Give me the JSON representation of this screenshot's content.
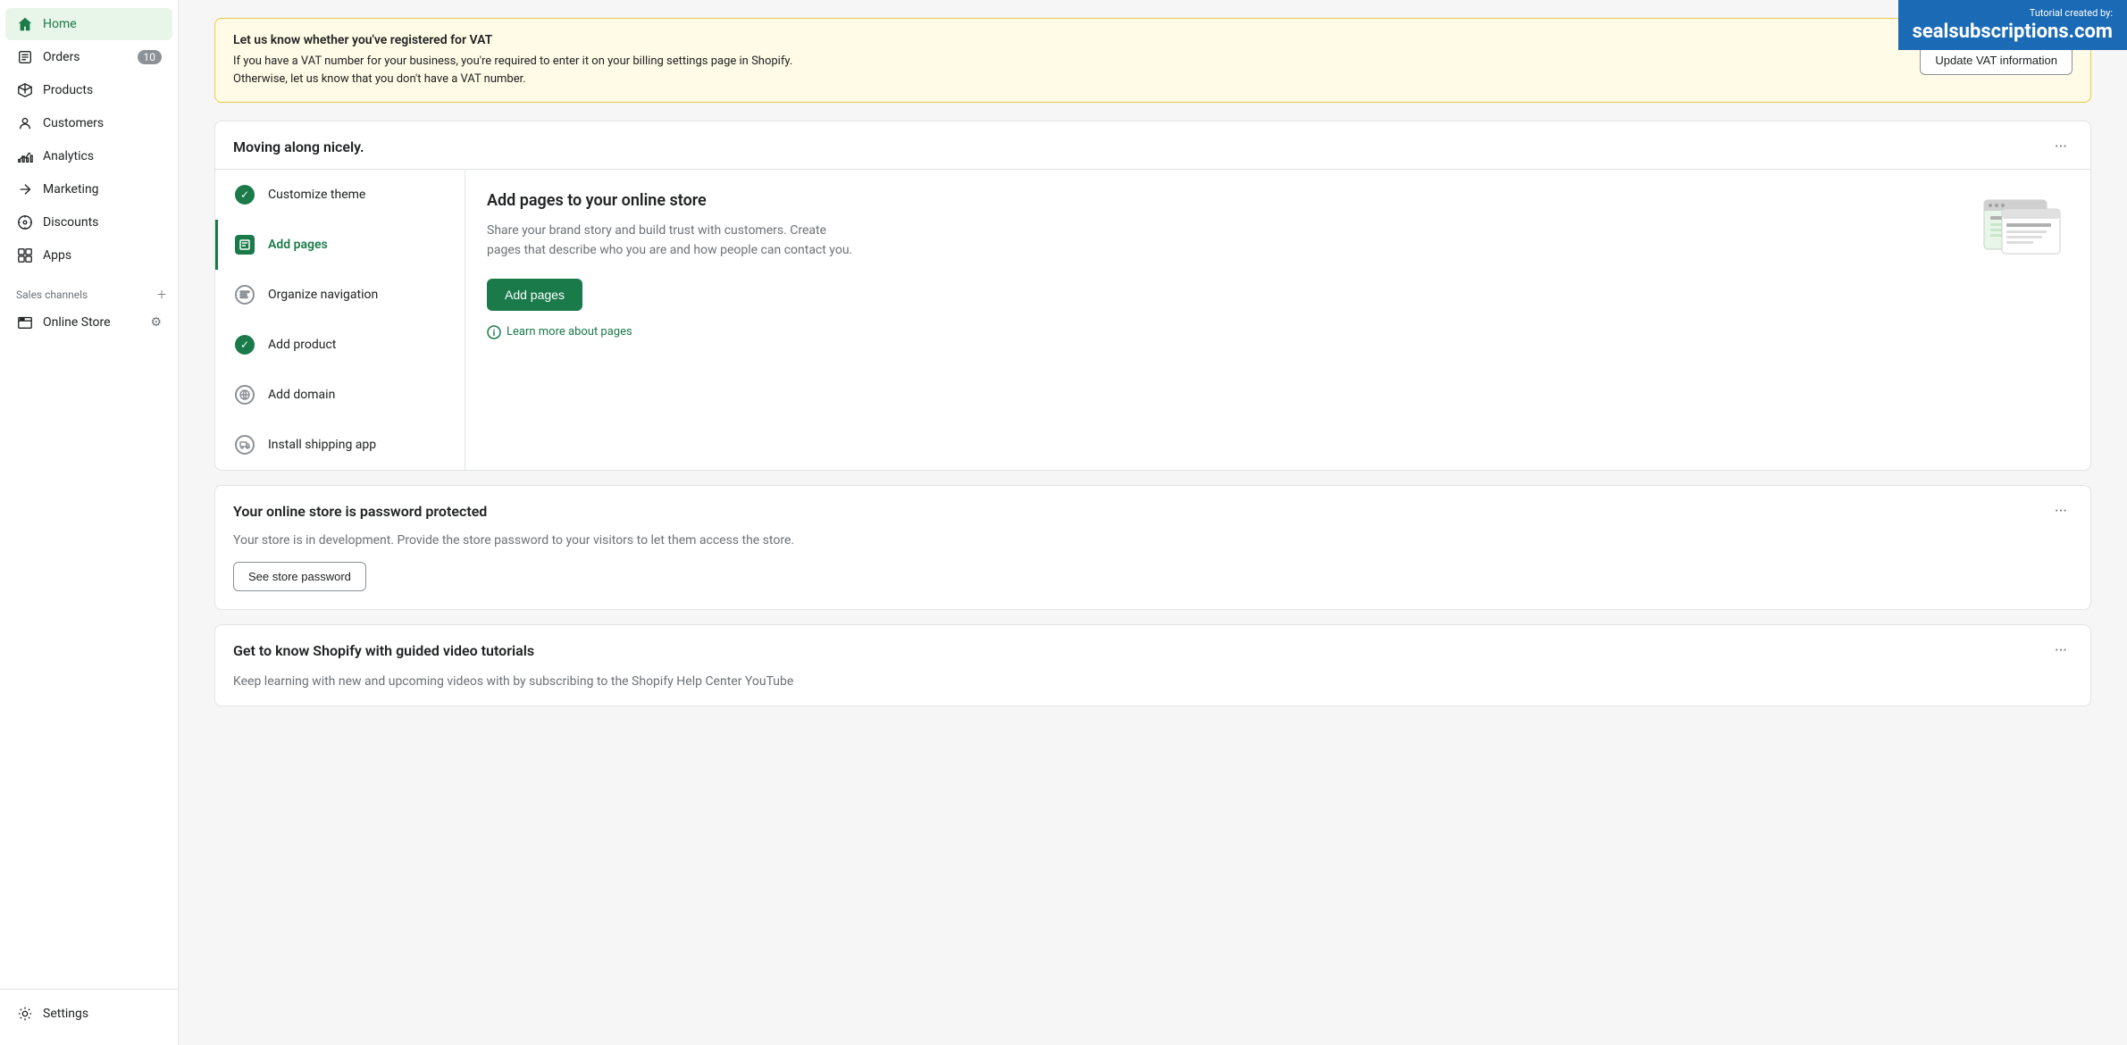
{
  "sidebar": {
    "items": [
      {
        "id": "home",
        "label": "Home",
        "icon": "home",
        "active": true,
        "badge": null
      },
      {
        "id": "orders",
        "label": "Orders",
        "icon": "orders",
        "active": false,
        "badge": "10"
      },
      {
        "id": "products",
        "label": "Products",
        "icon": "products",
        "active": false,
        "badge": null
      },
      {
        "id": "customers",
        "label": "Customers",
        "icon": "customers",
        "active": false,
        "badge": null
      },
      {
        "id": "analytics",
        "label": "Analytics",
        "icon": "analytics",
        "active": false,
        "badge": null
      },
      {
        "id": "marketing",
        "label": "Marketing",
        "icon": "marketing",
        "active": false,
        "badge": null
      },
      {
        "id": "discounts",
        "label": "Discounts",
        "icon": "discounts",
        "active": false,
        "badge": null
      },
      {
        "id": "apps",
        "label": "Apps",
        "icon": "apps",
        "active": false,
        "badge": null
      }
    ],
    "sales_channels_label": "Sales channels",
    "online_store_label": "Online Store",
    "settings_label": "Settings"
  },
  "vat_banner": {
    "title": "Let us know whether you've registered for VAT",
    "description": "If you have a VAT number for your business, you're required to enter it on your billing settings page in Shopify. Otherwise, let us know that you don't have a VAT number.",
    "button_label": "Update VAT information"
  },
  "moving_along": {
    "title": "Moving along nicely.",
    "more_label": "···",
    "steps": [
      {
        "id": "customize-theme",
        "label": "Customize theme",
        "status": "complete"
      },
      {
        "id": "add-pages",
        "label": "Add pages",
        "status": "active"
      },
      {
        "id": "organize-navigation",
        "label": "Organize navigation",
        "status": "pending"
      },
      {
        "id": "add-product",
        "label": "Add product",
        "status": "complete"
      },
      {
        "id": "add-domain",
        "label": "Add domain",
        "status": "globe"
      },
      {
        "id": "install-shipping-app",
        "label": "Install shipping app",
        "status": "truck"
      }
    ],
    "content": {
      "title": "Add pages to your online store",
      "description": "Share your brand story and build trust with customers. Create pages that describe who you are and how people can contact you.",
      "button_label": "Add pages",
      "learn_more_label": "Learn more about pages"
    }
  },
  "password_card": {
    "title": "Your online store is password protected",
    "description": "Your store is in development. Provide the store password to your visitors to let them access the store.",
    "button_label": "See store password",
    "more_label": "···"
  },
  "tutorial_card": {
    "title": "Get to know Shopify with guided video tutorials",
    "description": "Keep learning with new and upcoming videos with by subscribing to the Shopify Help Center YouTube",
    "more_label": "···"
  },
  "watermark": {
    "created_by": "Tutorial created by:",
    "url": "sealsubscriptions.com"
  }
}
